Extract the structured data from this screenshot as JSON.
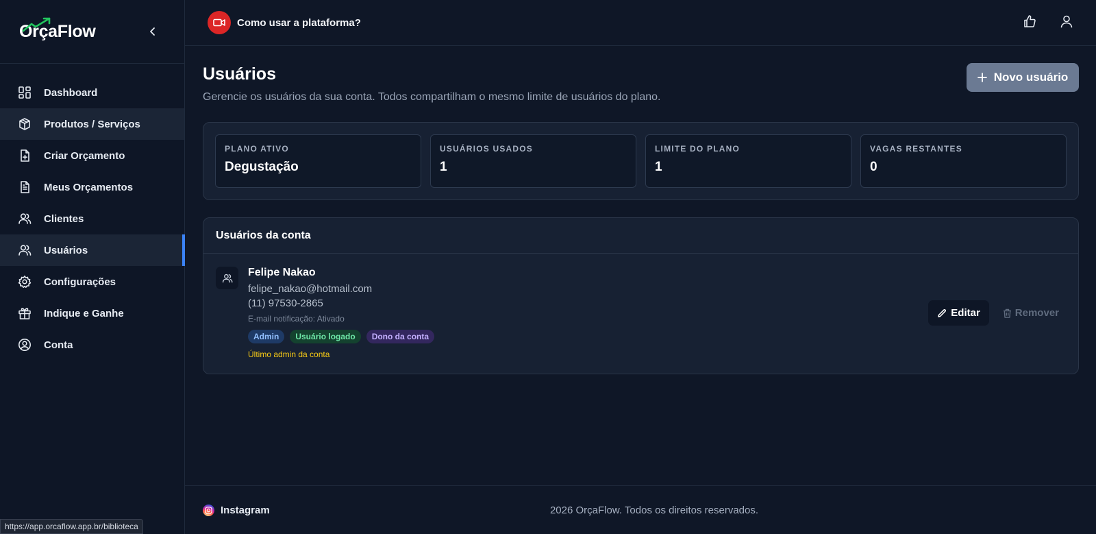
{
  "app": {
    "logo_text": "OrçaFlow",
    "status_url": "https://app.orcaflow.app.br/biblioteca"
  },
  "colors": {
    "accent": "#3b82f6",
    "video_button": "#dc2626",
    "primary_button": "#6b7a93",
    "warning_text": "#facc15"
  },
  "sidebar": {
    "items": [
      {
        "label": "Dashboard",
        "icon": "dashboard-icon"
      },
      {
        "label": "Produtos / Serviços",
        "icon": "box-icon"
      },
      {
        "label": "Criar Orçamento",
        "icon": "file-plus-icon"
      },
      {
        "label": "Meus Orçamentos",
        "icon": "file-text-icon"
      },
      {
        "label": "Clientes",
        "icon": "users-icon"
      },
      {
        "label": "Usuários",
        "icon": "users-icon"
      },
      {
        "label": "Configurações",
        "icon": "gear-icon"
      },
      {
        "label": "Indique e Ganhe",
        "icon": "gift-icon"
      },
      {
        "label": "Conta",
        "icon": "user-circle-icon"
      }
    ]
  },
  "topbar": {
    "help_label": "Como usar a plataforma?"
  },
  "page": {
    "title": "Usuários",
    "subtitle": "Gerencie os usuários da sua conta. Todos compartilham o mesmo limite de usuários do plano.",
    "new_user_label": "Novo usuário"
  },
  "stats": [
    {
      "label": "PLANO ATIVO",
      "value": "Degustação"
    },
    {
      "label": "USUÁRIOS USADOS",
      "value": "1"
    },
    {
      "label": "LIMITE DO PLANO",
      "value": "1"
    },
    {
      "label": "VAGAS RESTANTES",
      "value": "0"
    }
  ],
  "users_panel": {
    "title": "Usuários da conta",
    "users": [
      {
        "name": "Felipe Nakao",
        "email": "felipe_nakao@hotmail.com",
        "phone": "(11) 97530-2865",
        "notification": "E-mail notificação: Ativado",
        "badges": [
          "Admin",
          "Usuário logado",
          "Dono da conta"
        ],
        "warning": "Último admin da conta",
        "edit_label": "Editar",
        "remove_label": "Remover"
      }
    ]
  },
  "footer": {
    "instagram_label": "Instagram",
    "copyright": "2026 OrçaFlow. Todos os direitos reservados."
  }
}
